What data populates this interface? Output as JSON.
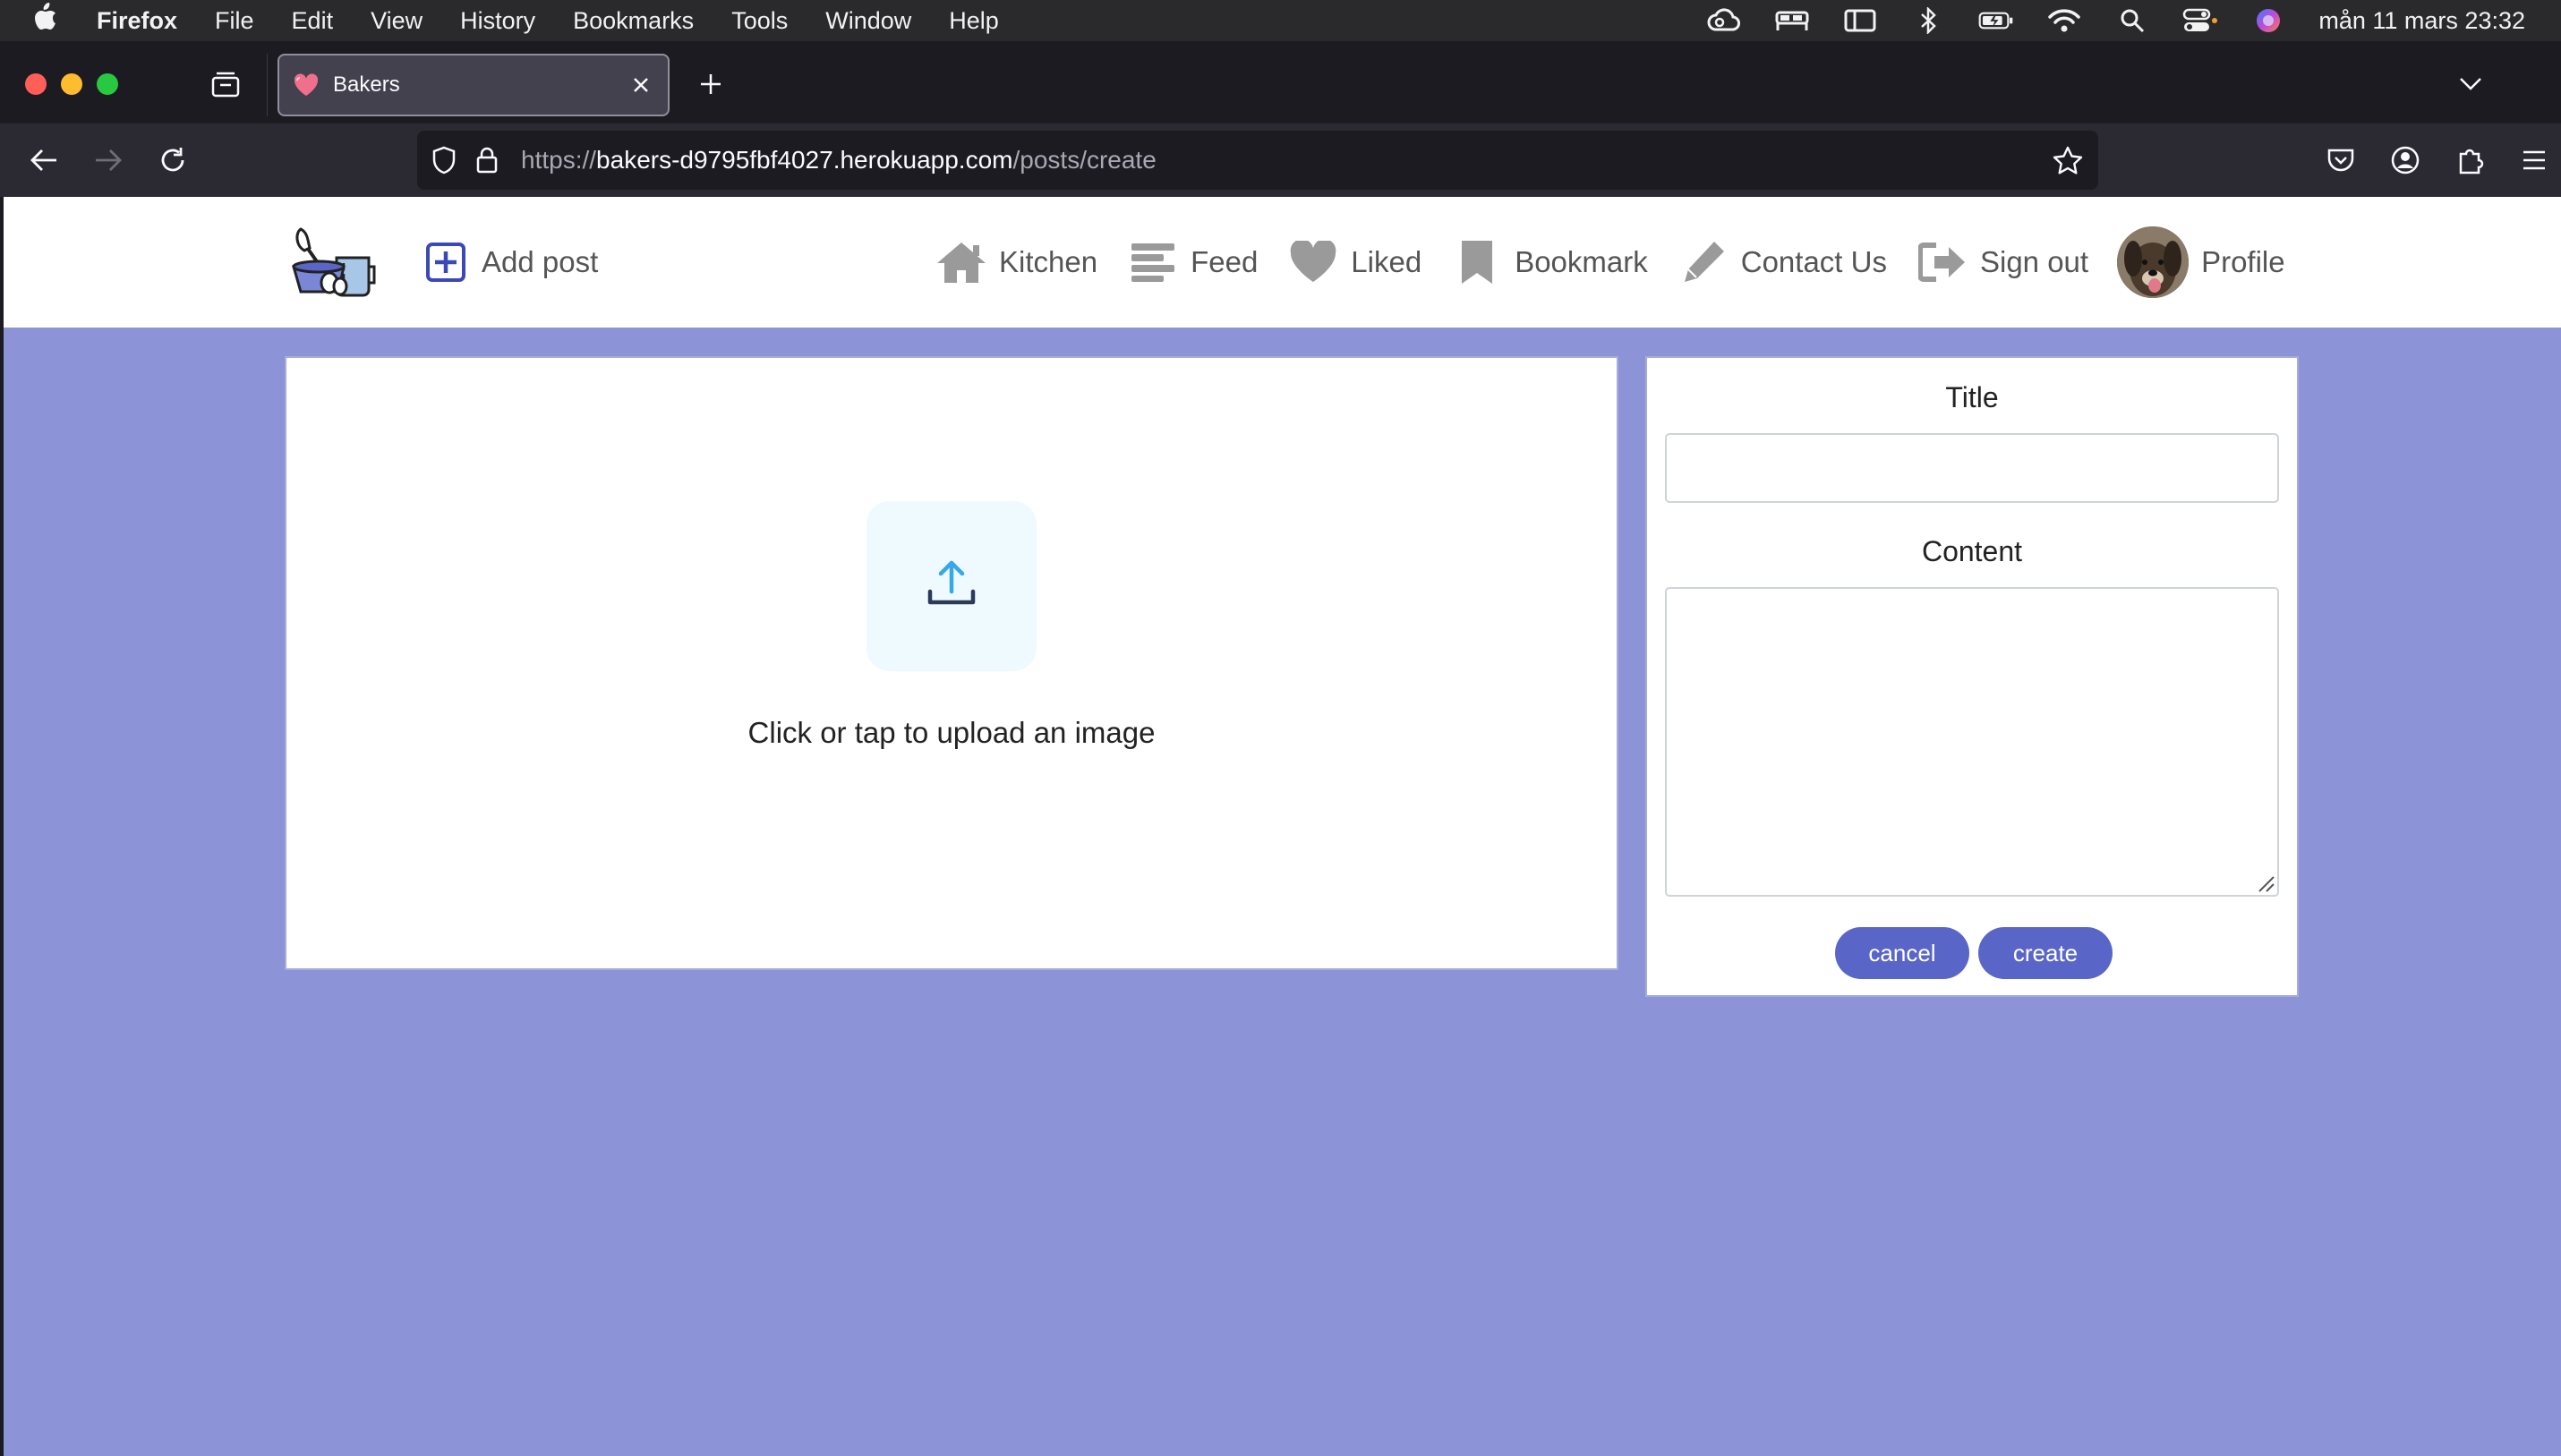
{
  "os_menubar": {
    "app_name": "Firefox",
    "menus": [
      "File",
      "Edit",
      "View",
      "History",
      "Bookmarks",
      "Tools",
      "Window",
      "Help"
    ],
    "clock": "mån 11 mars 23:32",
    "status_icons": [
      "creative-cloud-icon",
      "bed-icon",
      "sidebar-icon",
      "bluetooth-icon",
      "battery-icon",
      "wifi-icon",
      "spotlight-search-icon",
      "control-center-icon",
      "siri-icon"
    ]
  },
  "browser": {
    "tab": {
      "title": "Bakers",
      "favicon": "heart-icon"
    },
    "url": {
      "scheme": "https://",
      "host": "bakers-d9795fbf4027.herokuapp.com",
      "path": "/posts/create"
    }
  },
  "site": {
    "nav": {
      "add_post": "Add post",
      "links": [
        {
          "label": "Kitchen",
          "icon": "home-icon"
        },
        {
          "label": "Feed",
          "icon": "list-icon"
        },
        {
          "label": "Liked",
          "icon": "heart-icon"
        },
        {
          "label": "Bookmark",
          "icon": "bookmark-icon"
        },
        {
          "label": "Contact Us",
          "icon": "pencil-icon"
        },
        {
          "label": "Sign out",
          "icon": "sign-out-icon"
        }
      ],
      "profile": "Profile"
    },
    "upload": {
      "text": "Click or tap to upload an image"
    },
    "form": {
      "title_label": "Title",
      "title_value": "",
      "content_label": "Content",
      "content_value": "",
      "cancel_label": "cancel",
      "create_label": "create"
    },
    "colors": {
      "page_bg": "#8c93d6",
      "button": "#5a66c7",
      "nav_text": "#555555"
    }
  }
}
